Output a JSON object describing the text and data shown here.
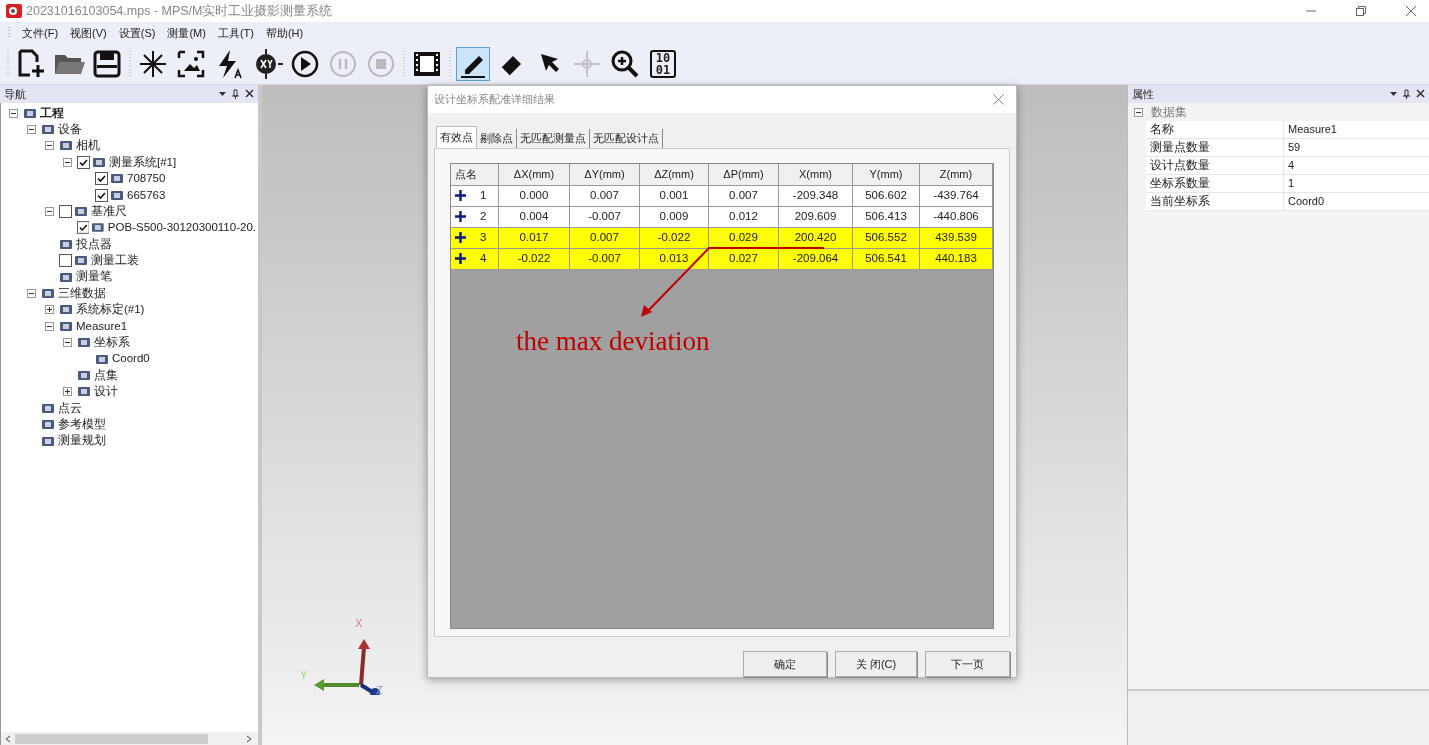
{
  "window": {
    "title": "20231016103054.mps - MPS/M实时工业摄影测量系统"
  },
  "menu": [
    "文件(F)",
    "视图(V)",
    "设置(S)",
    "测量(M)",
    "工具(T)",
    "帮助(H)"
  ],
  "toolbar": {
    "groups": [
      {
        "tools": [
          {
            "kind": "new",
            "selected": false,
            "disabled": false
          },
          {
            "kind": "open",
            "selected": false,
            "disabled": false
          },
          {
            "kind": "save",
            "selected": false,
            "disabled": false
          }
        ]
      },
      {
        "tools": [
          {
            "kind": "burst",
            "selected": false,
            "disabled": false
          },
          {
            "kind": "image",
            "selected": false,
            "disabled": false
          },
          {
            "kind": "flash",
            "selected": false,
            "disabled": false
          },
          {
            "kind": "xy",
            "selected": false,
            "disabled": false
          },
          {
            "kind": "play",
            "selected": false,
            "disabled": false
          },
          {
            "kind": "pause",
            "selected": false,
            "disabled": true
          },
          {
            "kind": "stop",
            "selected": false,
            "disabled": true
          }
        ]
      },
      {
        "tools": [
          {
            "kind": "film",
            "selected": false,
            "disabled": false
          }
        ]
      },
      {
        "tools": [
          {
            "kind": "pencil",
            "selected": true,
            "disabled": false
          },
          {
            "kind": "eraser",
            "selected": false,
            "disabled": false
          },
          {
            "kind": "pointer",
            "selected": false,
            "disabled": false
          },
          {
            "kind": "crosshair",
            "selected": false,
            "disabled": true
          },
          {
            "kind": "zoom",
            "selected": false,
            "disabled": false
          },
          {
            "kind": "binary",
            "selected": false,
            "disabled": false,
            "text_lines": [
              "10",
              "01"
            ]
          }
        ]
      }
    ]
  },
  "navigator": {
    "title": "导航",
    "tree": [
      {
        "label": "工程",
        "expanded": true,
        "bold": true,
        "children": [
          {
            "label": "设备",
            "expanded": true,
            "children": [
              {
                "label": "相机",
                "expanded": true,
                "children": [
                  {
                    "label": "测量系统[#1]",
                    "expanded": true,
                    "checked": true,
                    "children": [
                      {
                        "label": "708750",
                        "checked": true
                      },
                      {
                        "label": "665763",
                        "checked": true
                      }
                    ]
                  }
                ]
              },
              {
                "label": "基准尺",
                "expanded": true,
                "checked": false,
                "children": [
                  {
                    "label": "POB-S500-30120300110-20.",
                    "checked": true
                  }
                ]
              },
              {
                "label": "投点器"
              },
              {
                "label": "测量工装",
                "checked": false
              },
              {
                "label": "测量笔"
              }
            ]
          },
          {
            "label": "三维数据",
            "expanded": true,
            "children": [
              {
                "label": "系统标定(#1)",
                "expanded": false
              },
              {
                "label": "Measure1",
                "expanded": true,
                "children": [
                  {
                    "label": "坐标系",
                    "expanded": true,
                    "children": [
                      {
                        "label": "Coord0"
                      }
                    ]
                  },
                  {
                    "label": "点集"
                  },
                  {
                    "label": "设计",
                    "expanded": false
                  }
                ]
              }
            ]
          },
          {
            "label": "点云"
          },
          {
            "label": "参考模型"
          },
          {
            "label": "测量规划"
          }
        ]
      }
    ]
  },
  "viewport": {
    "axis_labels": [
      "X",
      "Y",
      "Z"
    ]
  },
  "dialog": {
    "title": "设计坐标系配准详细结果",
    "tabs": [
      {
        "label": "有效点",
        "selected": true
      },
      {
        "label": "剔除点",
        "selected": false
      },
      {
        "label": "无匹配测量点",
        "selected": false
      },
      {
        "label": "无匹配设计点",
        "selected": false
      }
    ],
    "table": {
      "columns": [
        "点名",
        "ΔX(mm)",
        "ΔY(mm)",
        "ΔZ(mm)",
        "ΔP(mm)",
        "X(mm)",
        "Y(mm)",
        "Z(mm)"
      ],
      "rows": [
        {
          "highlighted": false,
          "cells": [
            "1",
            "0.000",
            "0.007",
            "0.001",
            "0.007",
            "-209.348",
            "506.602",
            "-439.764"
          ]
        },
        {
          "highlighted": false,
          "cells": [
            "2",
            "0.004",
            "-0.007",
            "0.009",
            "0.012",
            "209.609",
            "506.413",
            "-440.806"
          ]
        },
        {
          "highlighted": true,
          "cells": [
            "3",
            "0.017",
            "0.007",
            "-0.022",
            "0.029",
            "200.420",
            "506.552",
            "439.539"
          ]
        },
        {
          "highlighted": true,
          "cells": [
            "4",
            "-0.022",
            "-0.007",
            "0.013",
            "0.027",
            "-209.064",
            "506.541",
            "440.183"
          ]
        }
      ]
    },
    "annotation": {
      "text": "the max deviation"
    },
    "buttons": [
      "确定",
      "关 闭(C)",
      "下一页"
    ]
  },
  "properties": {
    "title": "属性",
    "category": {
      "label": "数据集",
      "expanded": true
    },
    "rows": [
      {
        "name": "名称",
        "value": "Measure1"
      },
      {
        "name": "测量点数量",
        "value": "59"
      },
      {
        "name": "设计点数量",
        "value": "4"
      },
      {
        "name": "坐标系数量",
        "value": "1"
      },
      {
        "name": "当前坐标系",
        "value": "Coord0"
      }
    ]
  }
}
